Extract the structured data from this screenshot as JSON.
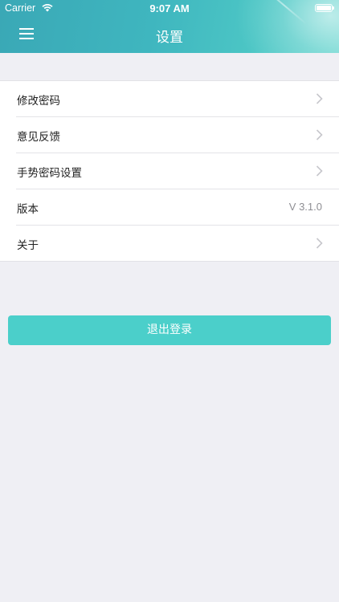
{
  "status_bar": {
    "carrier": "Carrier",
    "time": "9:07 AM",
    "battery_level": 1.0
  },
  "header": {
    "title": "设置",
    "menu_icon": "hamburger-menu-icon",
    "accent_colors": [
      "#3aa8b6",
      "#4cc6c5"
    ]
  },
  "settings": {
    "items": [
      {
        "label": "修改密码",
        "value": "",
        "icon": "chevron-right-icon"
      },
      {
        "label": "意见反馈",
        "value": "",
        "icon": "chevron-right-icon"
      },
      {
        "label": "手势密码设置",
        "value": "",
        "icon": "chevron-right-icon"
      },
      {
        "label": "版本",
        "value": "V 3.1.0",
        "icon": ""
      },
      {
        "label": "关于",
        "value": "",
        "icon": "chevron-right-icon"
      }
    ]
  },
  "logout": {
    "label": "退出登录",
    "color": "#4bcfca"
  },
  "background_color": "#efeff4"
}
